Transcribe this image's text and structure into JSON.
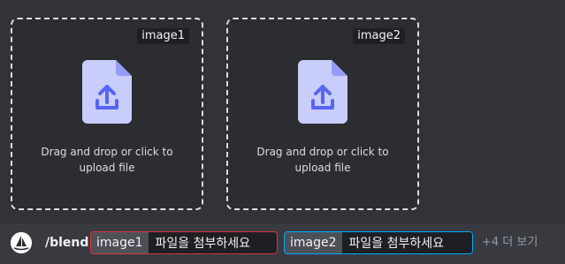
{
  "upload_boxes": [
    {
      "tag": "image1",
      "hint_line1": "Drag and drop or click to",
      "hint_line2": "upload file",
      "icon": "upload-file-icon"
    },
    {
      "tag": "image2",
      "hint_line1": "Drag and drop or click to",
      "hint_line2": "upload file",
      "icon": "upload-file-icon"
    }
  ],
  "command": {
    "name": "/blend",
    "icon": "sailboat-logo-icon",
    "options": [
      {
        "name": "image1",
        "value": "파일을 첨부하세요",
        "status": "error"
      },
      {
        "name": "image2",
        "value": "파일을 첨부하세요",
        "status": "active"
      }
    ],
    "more_label": "+4 더 보기"
  },
  "colors": {
    "background": "#313338",
    "box_border": "#dbdee1",
    "error_outline": "#da373c",
    "active_outline": "#00a8fc",
    "icon_page": "#c9cdfb",
    "icon_accent": "#5865f2"
  }
}
